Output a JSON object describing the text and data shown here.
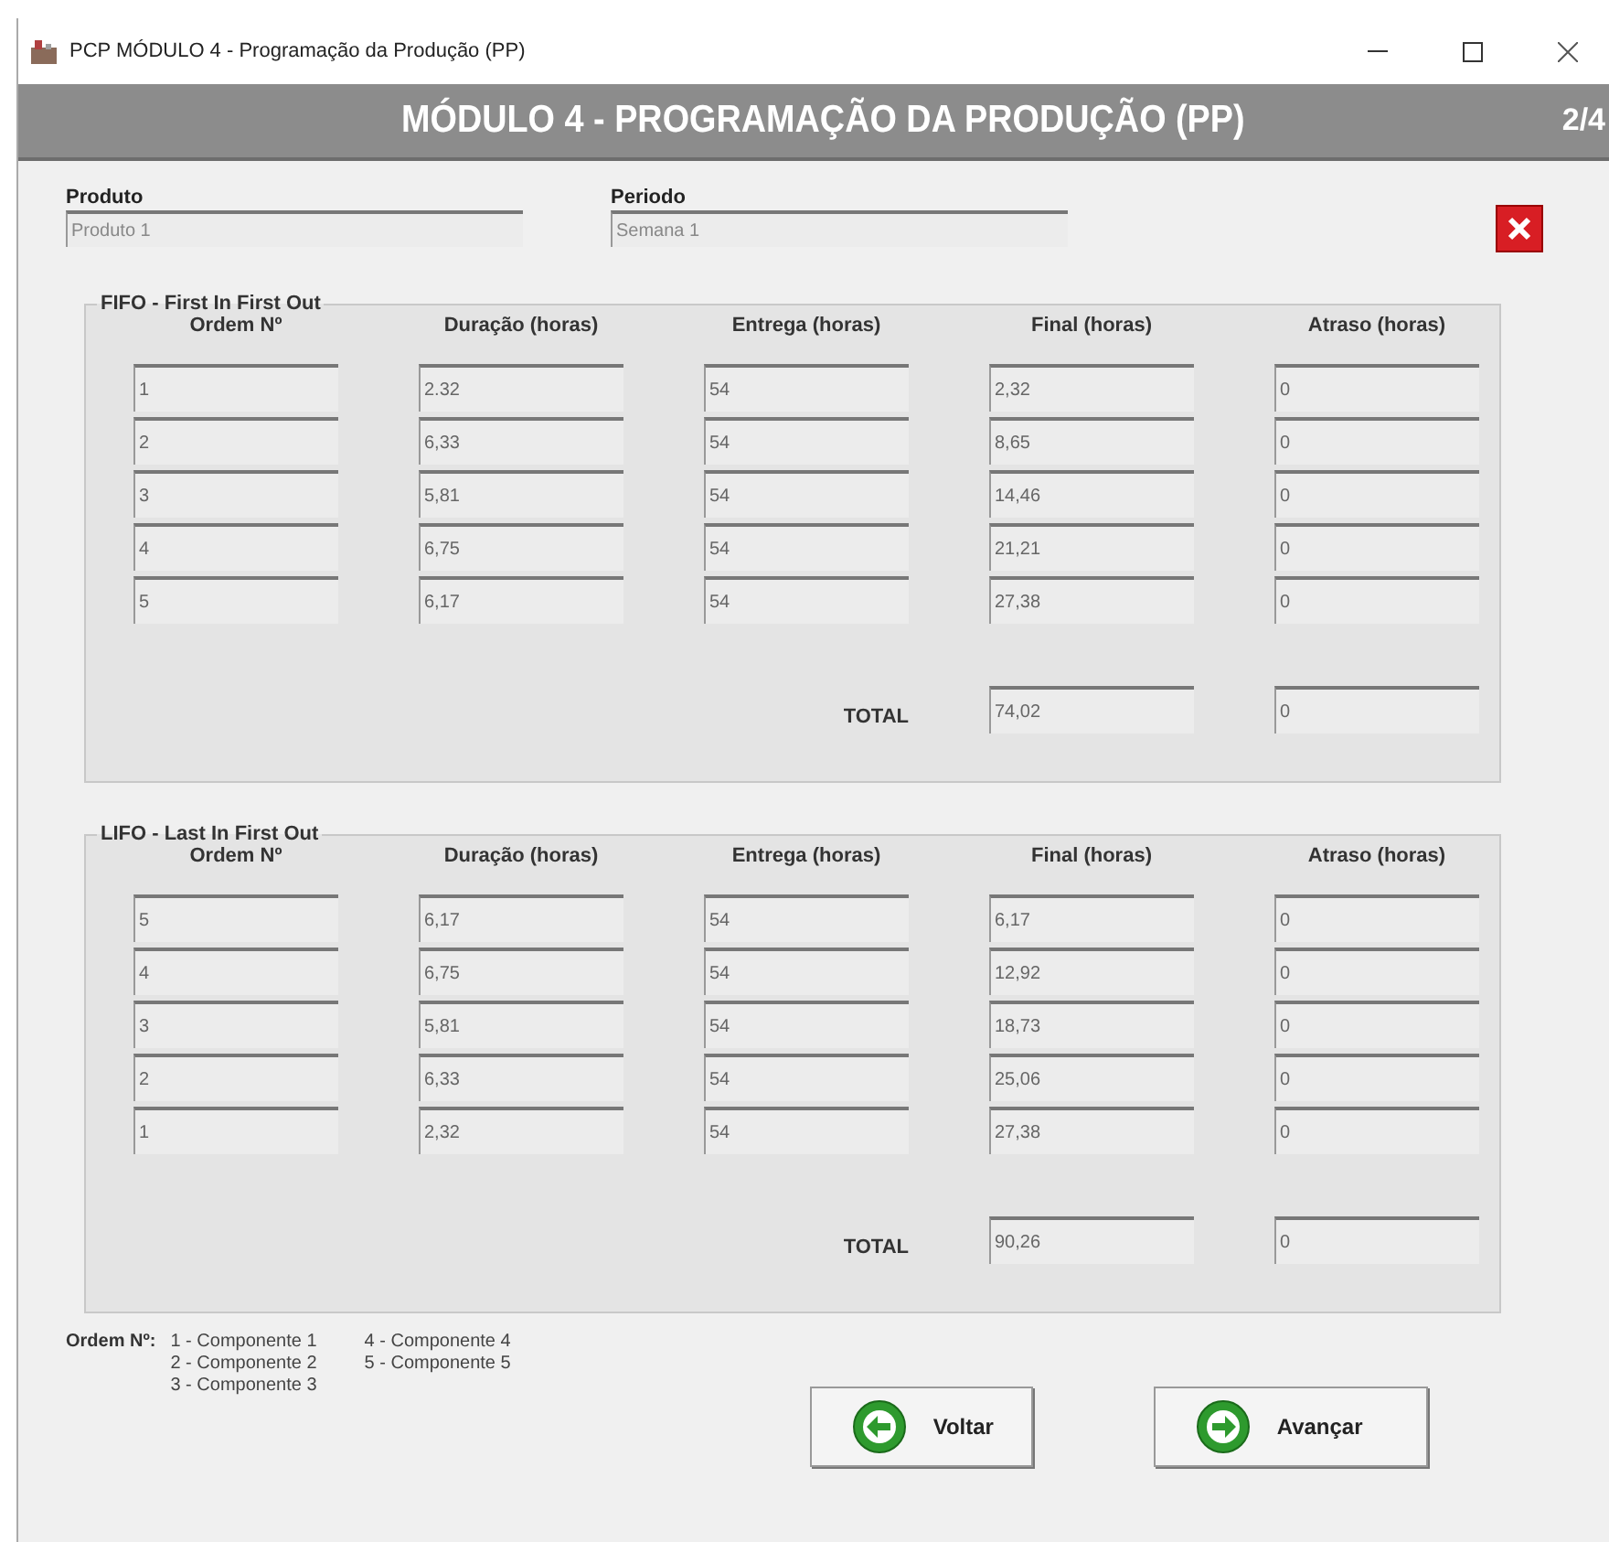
{
  "window": {
    "title": "PCP MÓDULO 4 - Programação da Produção (PP)"
  },
  "header": {
    "title": "MÓDULO 4 - PROGRAMAÇÃO DA PRODUÇÃO (PP)",
    "page": "2/4"
  },
  "fields": [
    {
      "label": "Produto",
      "value": "Produto 1"
    },
    {
      "label": "Periodo",
      "value": "Semana 1"
    }
  ],
  "sections": [
    {
      "title": "FIFO - First In First Out",
      "columns": [
        "Ordem Nº",
        "Duração (horas)",
        "Entrega (horas)",
        "Final (horas)",
        "Atraso (horas)"
      ],
      "rows": [
        [
          "1",
          "2.32",
          "54",
          "2,32",
          "0"
        ],
        [
          "2",
          "6,33",
          "54",
          "8,65",
          "0"
        ],
        [
          "3",
          "5,81",
          "54",
          "14,46",
          "0"
        ],
        [
          "4",
          "6,75",
          "54",
          "21,21",
          "0"
        ],
        [
          "5",
          "6,17",
          "54",
          "27,38",
          "0"
        ]
      ],
      "total_label": "TOTAL",
      "totals": [
        "74,02",
        "0"
      ]
    },
    {
      "title": "LIFO - Last In First Out",
      "columns": [
        "Ordem Nº",
        "Duração (horas)",
        "Entrega (horas)",
        "Final (horas)",
        "Atraso (horas)"
      ],
      "rows": [
        [
          "5",
          "6,17",
          "54",
          "6,17",
          "0"
        ],
        [
          "4",
          "6,75",
          "54",
          "12,92",
          "0"
        ],
        [
          "3",
          "5,81",
          "54",
          "18,73",
          "0"
        ],
        [
          "2",
          "6,33",
          "54",
          "25,06",
          "0"
        ],
        [
          "1",
          "2,32",
          "54",
          "27,38",
          "0"
        ]
      ],
      "total_label": "TOTAL",
      "totals": [
        "90,26",
        "0"
      ]
    }
  ],
  "legend": {
    "label": "Ordem Nº:",
    "items": [
      "1 - Componente 1",
      "2 - Componente 2",
      "3 - Componente 3",
      "4 - Componente 4",
      "5 - Componente 5"
    ]
  },
  "buttons": [
    {
      "label": "Voltar",
      "kind": "back"
    },
    {
      "label": "Avançar",
      "kind": "next"
    }
  ]
}
